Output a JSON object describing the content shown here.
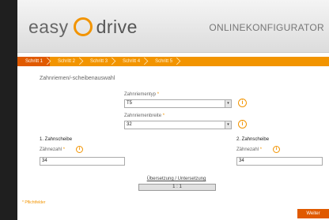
{
  "header": {
    "logo_left": "easy",
    "logo_right": "drive",
    "title": "ONLINEKONFIGURATOR"
  },
  "steps": [
    {
      "label": "Schritt 1",
      "active": true
    },
    {
      "label": "Schritt 2",
      "active": false
    },
    {
      "label": "Schritt 3",
      "active": false
    },
    {
      "label": "Schritt 4",
      "active": false
    },
    {
      "label": "Schritt 5",
      "active": false
    }
  ],
  "section_title": "Zahnriemen/-scheibenauswahl",
  "belt_type": {
    "label": "Zahnriementyp",
    "required_mark": "*",
    "value": "T5"
  },
  "belt_width": {
    "label": "Zahnriemenbreite",
    "required_mark": "*",
    "value": "32"
  },
  "pulley1": {
    "heading": "1. Zahnscheibe",
    "teeth_label": "Zähnezahl",
    "required_mark": "*",
    "value": "34"
  },
  "pulley2": {
    "heading": "2. Zahnscheibe",
    "teeth_label": "Zähnezahl",
    "required_mark": "*",
    "value": "34"
  },
  "ratio": {
    "label": "Übersetzung / Untersetzung",
    "value": "1 : 1"
  },
  "footnote": "* Pflichtfelder",
  "next_label": "Weiter",
  "info_glyph": "i",
  "select_arrow": "▾",
  "colors": {
    "accent": "#f29400",
    "active_step": "#e05a00",
    "background": "#1f1f1f"
  }
}
